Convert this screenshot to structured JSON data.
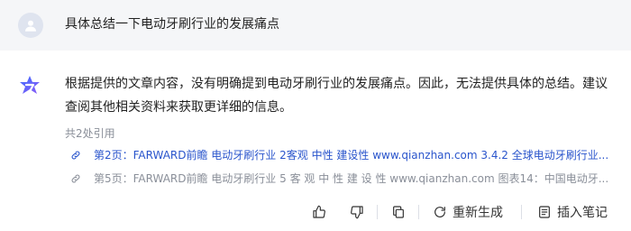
{
  "question": {
    "avatar_icon": "user-icon",
    "text": "具体总结一下电动牙刷行业的发展痛点"
  },
  "answer": {
    "logo_icon": "ai-assistant-logo-icon",
    "text": "根据提供的文章内容，没有明确提到电动牙刷行业的发展痛点。因此，无法提供具体的总结。建议查阅其他相关资料来获取更详细的信息。"
  },
  "citations": {
    "title": "共2处引用",
    "items": [
      {
        "icon": "link-icon",
        "text": "第2页：FARWARD前瞻 电动牙刷行业 2客观 中性 建设性 www.qianzhan.com 3.4.2 全球电动牙刷行业..."
      },
      {
        "icon": "link-icon",
        "text": "第5页：FARWARD前瞻 电动牙刷行业 5 客 观 中 性 建 设 性 www.qianzhan.com 图表14：中国电动牙..."
      }
    ]
  },
  "actions": {
    "like_icon": "thumbs-up-icon",
    "dislike_icon": "thumbs-down-icon",
    "copy_icon": "copy-icon",
    "regenerate_icon": "refresh-icon",
    "regenerate_label": "重新生成",
    "note_icon": "note-icon",
    "note_label": "插入笔记"
  },
  "colors": {
    "link_blue": "#2a55cc",
    "muted_gray": "#8a8f99",
    "question_bg": "#f5f6f8",
    "logo_gradient": [
      "#3d6bff",
      "#8b5cf6"
    ]
  }
}
